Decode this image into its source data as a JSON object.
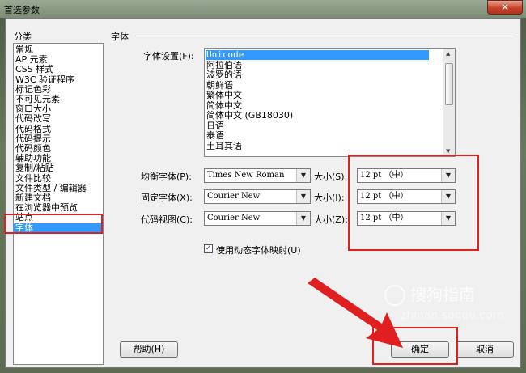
{
  "window": {
    "title": "首选参数",
    "close_glyph": "✕"
  },
  "categories": {
    "label": "分类",
    "items": [
      "常规",
      "AP 元素",
      "CSS 样式",
      "W3C 验证程序",
      "标记色彩",
      "不可见元素",
      "窗口大小",
      "代码改写",
      "代码格式",
      "代码提示",
      "代码颜色",
      "辅助功能",
      "复制/粘贴",
      "文件比较",
      "文件类型 / 编辑器",
      "新建文档",
      "在浏览器中预览",
      "站点",
      "字体"
    ],
    "selected_index": 18
  },
  "section": {
    "title": "字体"
  },
  "font_setting": {
    "label": "字体设置(F):",
    "items": [
      "Unicode",
      "阿拉伯语",
      "波罗的语",
      "朝鲜语",
      "繁体中文",
      "简体中文",
      "简体中文 (GB18030)",
      "日语",
      "泰语",
      "土耳其语"
    ],
    "selected_index": 0
  },
  "rows": [
    {
      "label": "均衡字体(P):",
      "font": "Times New Roman",
      "size_label": "大小(S):",
      "size": "12 pt （中）"
    },
    {
      "label": "固定字体(X):",
      "font": "Courier New",
      "size_label": "大小(I):",
      "size": "12 pt （中）"
    },
    {
      "label": "代码视图(C):",
      "font": "Courier New",
      "size_label": "大小(Z):",
      "size": "12 pt （中）"
    }
  ],
  "dynamic_mapping": {
    "label": "使用动态字体映射(U)",
    "checked": true,
    "check_glyph": "✓"
  },
  "buttons": {
    "help": "帮助(H)",
    "ok": "确定",
    "cancel": "取消"
  },
  "dropdown_glyph": "▼",
  "watermark": {
    "text": "搜狗指南",
    "url": "zhinan.sogou.com"
  },
  "colors": {
    "highlight": "#3399ff",
    "annotation_red": "#e02020"
  }
}
